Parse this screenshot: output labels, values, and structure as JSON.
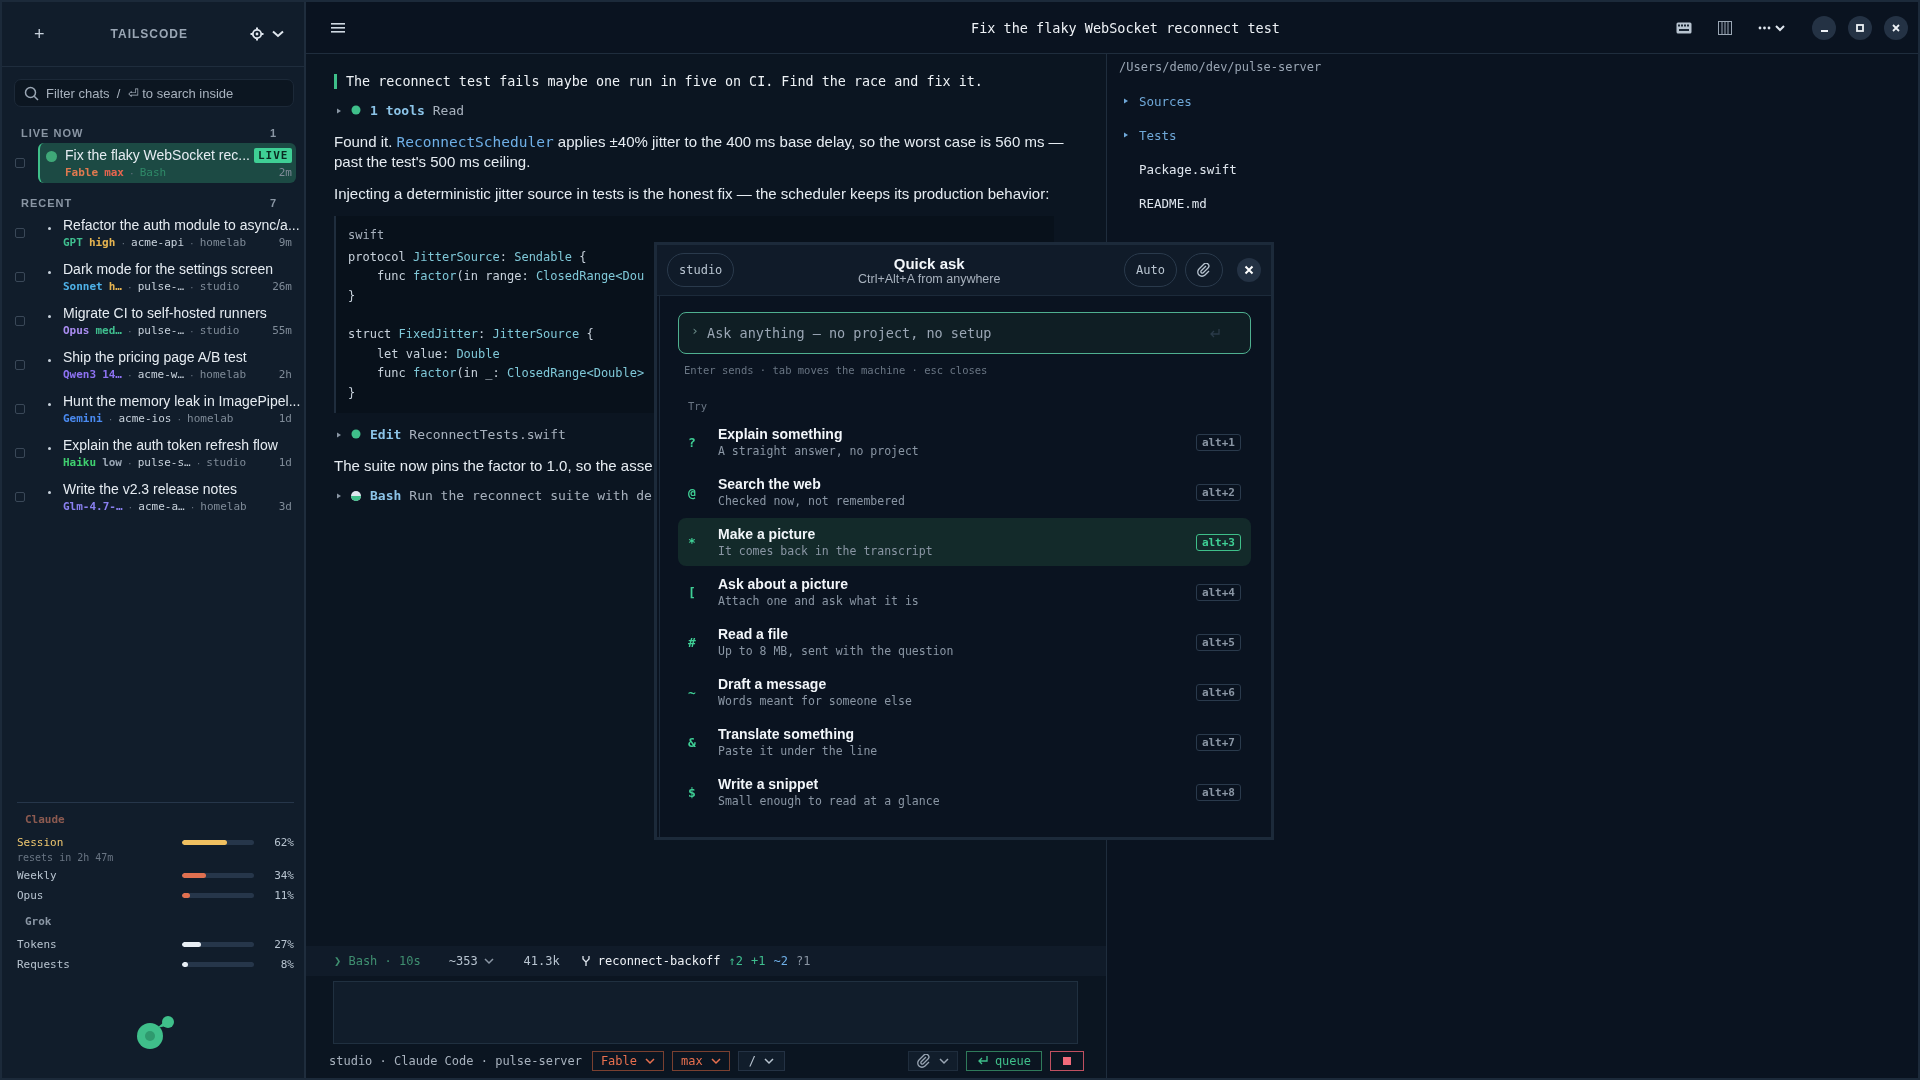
{
  "sidebar": {
    "add_label": "+",
    "brand": "TAILSCODE",
    "search": {
      "placeholder": "Filter chats  /  ⏎ to search inside"
    },
    "sections": [
      {
        "title": "LIVE NOW",
        "count": "1",
        "chats": [
          {
            "title": "Fix the flaky WebSocket rec...",
            "live": true,
            "badge": "LIVE",
            "selected": true,
            "checked": false,
            "model": {
              "text": "Fable",
              "color": "#e07a50"
            },
            "effort": {
              "text": "max",
              "color": "#e8654f"
            },
            "tags": [
              {
                "text": "Bash",
                "kind": "tool",
                "separator": "·"
              }
            ],
            "time": "2m"
          }
        ]
      },
      {
        "title": "RECENT",
        "count": "7",
        "chats": [
          {
            "title": "Refactor the auth module to async/a...",
            "live": false,
            "selected": false,
            "checked": false,
            "model": {
              "text": "GPT",
              "color": "#3fbf8f"
            },
            "effort": {
              "text": "high",
              "color": "#e6b450"
            },
            "tags": [
              {
                "text": "acme-api",
                "kind": "project",
                "separator": "·"
              },
              {
                "text": "homelab",
                "kind": "machine",
                "separator": "·"
              }
            ],
            "time": "9m"
          },
          {
            "title": "Dark mode for the settings screen",
            "live": false,
            "selected": false,
            "checked": false,
            "model": {
              "text": "Sonnet",
              "color": "#4fb3ea"
            },
            "effort": {
              "text": "h…",
              "color": "#e6b450"
            },
            "tags": [
              {
                "text": "pulse-…",
                "kind": "project",
                "separator": "·"
              },
              {
                "text": "studio",
                "kind": "machine",
                "separator": "·"
              }
            ],
            "time": "26m"
          },
          {
            "title": "Migrate CI to self-hosted runners",
            "live": false,
            "selected": false,
            "checked": false,
            "model": {
              "text": "Opus",
              "color": "#a98cf0"
            },
            "effort": {
              "text": "med…",
              "color": "#3fbf8f"
            },
            "tags": [
              {
                "text": "pulse-…",
                "kind": "project",
                "separator": "·"
              },
              {
                "text": "studio",
                "kind": "machine",
                "separator": "·"
              }
            ],
            "time": "55m"
          },
          {
            "title": "Ship the pricing page A/B test",
            "live": false,
            "selected": false,
            "checked": false,
            "model": {
              "text": "Qwen3",
              "color": "#8d72f2"
            },
            "effort": {
              "text": "14…",
              "color": "#8d72f2"
            },
            "tags": [
              {
                "text": "acme-w…",
                "kind": "project",
                "separator": "·"
              },
              {
                "text": "homelab",
                "kind": "machine",
                "separator": "·"
              }
            ],
            "time": "2h"
          },
          {
            "title": "Hunt the memory leak in ImagePipel...",
            "live": false,
            "selected": false,
            "checked": false,
            "model": {
              "text": "Gemini",
              "color": "#4a8af0"
            },
            "tags": [
              {
                "text": "acme-ios",
                "kind": "project",
                "separator": "·"
              },
              {
                "text": "homelab",
                "kind": "machine",
                "separator": "·"
              }
            ],
            "time": "1d"
          },
          {
            "title": "Explain the auth token refresh flow",
            "live": false,
            "selected": false,
            "checked": false,
            "model": {
              "text": "Haiku",
              "color": "#3fcf6f"
            },
            "effort": {
              "text": "low",
              "color": "#9aa6b4"
            },
            "tags": [
              {
                "text": "pulse-s…",
                "kind": "project",
                "separator": "·"
              },
              {
                "text": "studio",
                "kind": "machine",
                "separator": "·"
              }
            ],
            "time": "1d"
          },
          {
            "title": "Write the v2.3 release notes",
            "live": false,
            "selected": false,
            "checked": false,
            "model": {
              "text": "Glm-4.7-…",
              "color": "#8a80f0"
            },
            "tags": [
              {
                "text": "acme-a…",
                "kind": "project",
                "separator": "·"
              },
              {
                "text": "homelab",
                "kind": "machine",
                "separator": "·"
              }
            ],
            "time": "3d"
          }
        ]
      }
    ],
    "usage": [
      {
        "provider": "Claude",
        "color": "#8c5a50",
        "meters": [
          {
            "label": "Session",
            "level": 0.62,
            "reading": "62%",
            "color": "#f0c060",
            "emphasized": true,
            "note": "resets in 2h 47m"
          },
          {
            "label": "Weekly",
            "level": 0.34,
            "reading": "34%",
            "color": "#e07050",
            "emphasized": false
          },
          {
            "label": "Opus",
            "level": 0.11,
            "reading": "11%",
            "color": "#e07050",
            "emphasized": false
          }
        ]
      },
      {
        "provider": "Grok",
        "color": "#8a96a4",
        "meters": [
          {
            "label": "Tokens",
            "level": 0.27,
            "reading": "27%",
            "color": "#e8eef4",
            "emphasized": false
          },
          {
            "label": "Requests",
            "level": 0.08,
            "reading": "8%",
            "color": "#e8eef4",
            "emphasized": false
          }
        ]
      }
    ]
  },
  "topbar": {
    "title": "Fix the flaky WebSocket reconnect test"
  },
  "transcript": [
    {
      "kind": "prompt",
      "text": "The reconnect test fails maybe one run in five on CI. Find the race and fix it."
    },
    {
      "kind": "tool",
      "running": false,
      "name": "1 tools",
      "detail": "Read"
    },
    {
      "kind": "text",
      "parts": [
        {
          "text": "Found it. ",
          "kind": "plain"
        },
        {
          "text": "ReconnectScheduler",
          "kind": "code"
        },
        {
          "text": " applies ±40% jitter to the 400 ms base delay, so the worst case is 560 ms — past the test's 500 ms ceiling.",
          "kind": "plain"
        }
      ]
    },
    {
      "kind": "text",
      "parts": [
        {
          "text": "Injecting a deterministic jitter source in tests is the honest fix — the scheduler keeps its production behavior:",
          "kind": "plain"
        }
      ]
    },
    {
      "kind": "code",
      "language": "swift",
      "groups": [
        [
          [
            {
              "text": "protocol ",
              "kind": "plain"
            },
            {
              "text": "JitterSource",
              "kind": "type"
            },
            {
              "text": ": ",
              "kind": "plain"
            },
            {
              "text": "Sendable",
              "kind": "type"
            },
            {
              "text": " {",
              "kind": "plain"
            }
          ],
          [
            {
              "text": "    func ",
              "kind": "plain"
            },
            {
              "text": "factor",
              "kind": "type"
            },
            {
              "text": "(in range: ",
              "kind": "plain"
            },
            {
              "text": "ClosedRange<Dou",
              "kind": "type"
            }
          ],
          [
            {
              "text": "}",
              "kind": "plain"
            }
          ]
        ],
        [
          [
            {
              "text": "struct ",
              "kind": "plain"
            },
            {
              "text": "FixedJitter",
              "kind": "type"
            },
            {
              "text": ": ",
              "kind": "plain"
            },
            {
              "text": "JitterSource",
              "kind": "type"
            },
            {
              "text": " {",
              "kind": "plain"
            }
          ],
          [
            {
              "text": "    let value: ",
              "kind": "plain"
            },
            {
              "text": "Double",
              "kind": "type"
            }
          ],
          [
            {
              "text": "    func ",
              "kind": "plain"
            },
            {
              "text": "factor",
              "kind": "type"
            },
            {
              "text": "(in _: ",
              "kind": "plain"
            },
            {
              "text": "ClosedRange<Double>",
              "kind": "type"
            }
          ],
          [
            {
              "text": "}",
              "kind": "plain"
            }
          ]
        ]
      ]
    },
    {
      "kind": "tool",
      "running": false,
      "name": "Edit",
      "detail": "ReconnectTests.swift"
    },
    {
      "kind": "text",
      "parts": [
        {
          "text": "The suite now pins the factor to 1.0, so the asse",
          "kind": "plain"
        }
      ]
    },
    {
      "kind": "tool",
      "running": true,
      "name": "Bash",
      "detail": "Run the reconnect suite with de"
    }
  ],
  "explorer": {
    "path": "/Users/demo/dev/pulse-server",
    "items": [
      {
        "name": "Sources",
        "kind": "folder",
        "expanded": false
      },
      {
        "name": "Tests",
        "kind": "folder",
        "expanded": false
      },
      {
        "name": "Package.swift",
        "kind": "file"
      },
      {
        "name": "README.md",
        "kind": "file"
      }
    ]
  },
  "status_strip": {
    "activity": "❯ Bash · 10s",
    "lines": "~353",
    "tokens": "41.3k",
    "branch": "reconnect-backoff",
    "changes": [
      {
        "text": "↑2",
        "color": "#3fbf8f"
      },
      {
        "text": "+1",
        "color": "#3fbf8f"
      },
      {
        "text": "~2",
        "color": "#6fb0e8"
      },
      {
        "text": "?1",
        "color": "#8a96a4"
      }
    ]
  },
  "composer_footer": {
    "context": "studio · Claude Code · pulse-server",
    "selectors": [
      {
        "label": "Fable",
        "accent": true
      },
      {
        "label": "max",
        "accent": true
      },
      {
        "label": "/",
        "accent": false
      }
    ],
    "queue_label": "queue"
  },
  "quick_ask": {
    "machine": "studio",
    "title": "Quick ask",
    "subtitle": "Ctrl+Alt+A from anywhere",
    "mode": "Auto",
    "prompt_glyph": "›",
    "placeholder": "Ask anything — no project, no setup",
    "hint": "Enter sends · tab moves the machine · esc closes",
    "section": "Try",
    "items": [
      {
        "glyph": "?",
        "title": "Explain something",
        "description": "A straight answer, no project",
        "shortcut": "alt+1",
        "selected": false
      },
      {
        "glyph": "@",
        "title": "Search the web",
        "description": "Checked now, not remembered",
        "shortcut": "alt+2",
        "selected": false
      },
      {
        "glyph": "*",
        "title": "Make a picture",
        "description": "It comes back in the transcript",
        "shortcut": "alt+3",
        "selected": true
      },
      {
        "glyph": "[",
        "title": "Ask about a picture",
        "description": "Attach one and ask what it is",
        "shortcut": "alt+4",
        "selected": false
      },
      {
        "glyph": "#",
        "title": "Read a file",
        "description": "Up to 8 MB, sent with the question",
        "shortcut": "alt+5",
        "selected": false
      },
      {
        "glyph": "~",
        "title": "Draft a message",
        "description": "Words meant for someone else",
        "shortcut": "alt+6",
        "selected": false
      },
      {
        "glyph": "&",
        "title": "Translate something",
        "description": "Paste it under the line",
        "shortcut": "alt+7",
        "selected": false
      },
      {
        "glyph": "$",
        "title": "Write a snippet",
        "description": "Small enough to read at a glance",
        "shortcut": "alt+8",
        "selected": false
      }
    ]
  }
}
